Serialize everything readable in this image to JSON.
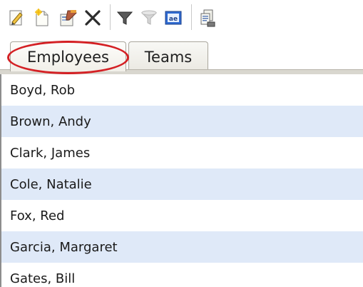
{
  "toolbar": {
    "buttons": [
      {
        "name": "edit-icon"
      },
      {
        "name": "new-item-icon"
      },
      {
        "name": "properties-icon"
      },
      {
        "name": "delete-icon"
      },
      {
        "name": "filter-icon"
      },
      {
        "name": "clear-filter-icon"
      },
      {
        "name": "text-view-icon"
      },
      {
        "name": "copy-icon"
      }
    ]
  },
  "tabs": [
    {
      "label": "Employees",
      "active": true
    },
    {
      "label": "Teams",
      "active": false
    }
  ],
  "highlight_color": "#d42024",
  "list": {
    "items": [
      "Boyd, Rob",
      "Brown, Andy",
      "Clark, James",
      "Cole, Natalie",
      "Fox, Red",
      "Garcia, Margaret",
      "Gates, Bill"
    ],
    "row_colors": [
      "#ffffff",
      "#dfe9f8"
    ]
  }
}
